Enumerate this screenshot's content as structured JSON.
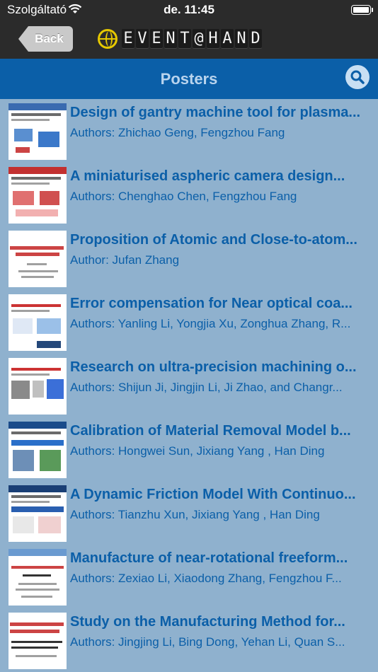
{
  "status": {
    "carrier": "Szolgáltató",
    "time": "de. 11:45"
  },
  "nav": {
    "back_label": "Back",
    "logo_text": "EVENT@HAND"
  },
  "header": {
    "title": "Posters"
  },
  "posters": [
    {
      "title": "Design of gantry machine tool for plasma...",
      "authors": "Authors: Zhichao Geng, Fengzhou Fang"
    },
    {
      "title": "A miniaturised aspheric camera design...",
      "authors": "Authors: Chenghao Chen, Fengzhou Fang"
    },
    {
      "title": "Proposition of Atomic and Close-to-atom...",
      "authors": "Author: Jufan Zhang"
    },
    {
      "title": "Error compensation for Near optical coa...",
      "authors": "Authors: Yanling Li, Yongjia Xu, Zonghua Zhang, R..."
    },
    {
      "title": "Research on ultra-precision machining o...",
      "authors": "Authors: Shijun Ji, Jingjin Li, Ji Zhao, and Changr..."
    },
    {
      "title": "Calibration of Material Removal Model b...",
      "authors": "Authors: Hongwei Sun, Jixiang Yang , Han Ding"
    },
    {
      "title": "A Dynamic Friction Model With Continuo...",
      "authors": "Authors: Tianzhu Xun, Jixiang Yang , Han Ding"
    },
    {
      "title": "Manufacture of near-rotational freeform...",
      "authors": "Authors: Zexiao Li, Xiaodong Zhang, Fengzhou F..."
    },
    {
      "title": "Study on the Manufacturing Method for...",
      "authors": "Authors: Jingjing Li, Bing Dong, Yehan Li, Quan S..."
    }
  ]
}
